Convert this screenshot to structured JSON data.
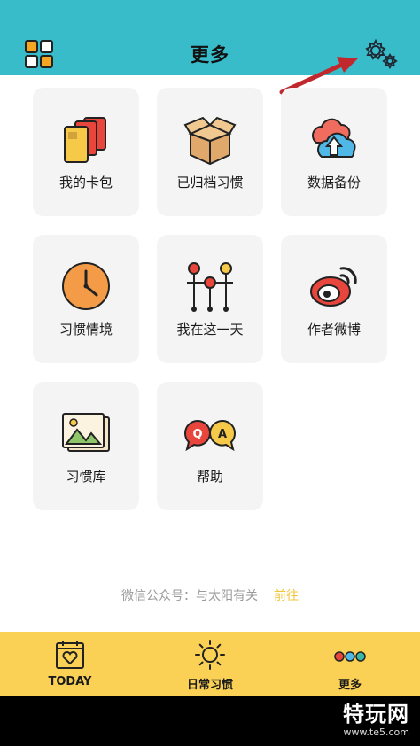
{
  "header": {
    "title": "更多",
    "left_icon": "grid-icon",
    "right_icon": "settings-gears-icon"
  },
  "cards": [
    {
      "label": "我的卡包",
      "icon": "card-wallet-icon"
    },
    {
      "label": "已归档习惯",
      "icon": "archive-box-icon"
    },
    {
      "label": "数据备份",
      "icon": "cloud-sync-icon"
    },
    {
      "label": "习惯情境",
      "icon": "clock-icon"
    },
    {
      "label": "我在这一天",
      "icon": "timeline-icon"
    },
    {
      "label": "作者微博",
      "icon": "weibo-icon"
    },
    {
      "label": "习惯库",
      "icon": "picture-library-icon"
    },
    {
      "label": "帮助",
      "icon": "qa-bubbles-icon"
    }
  ],
  "wechat": {
    "text": "微信公众号：与太阳有关",
    "link": "前往"
  },
  "tabbar": {
    "tabs": [
      {
        "label": "TODAY",
        "icon": "calendar-heart-icon"
      },
      {
        "label": "日常习惯",
        "icon": "sun-icon"
      },
      {
        "label": "更多",
        "icon": "three-dots-icon"
      }
    ]
  },
  "watermark": {
    "main": "特玩网",
    "sub": "www.te5.com"
  },
  "colors": {
    "header": "#38bcc9",
    "tabbar": "#fad155",
    "card_bg": "#f4f4f4",
    "link": "#f3c63a",
    "arrow": "#c0282d"
  }
}
